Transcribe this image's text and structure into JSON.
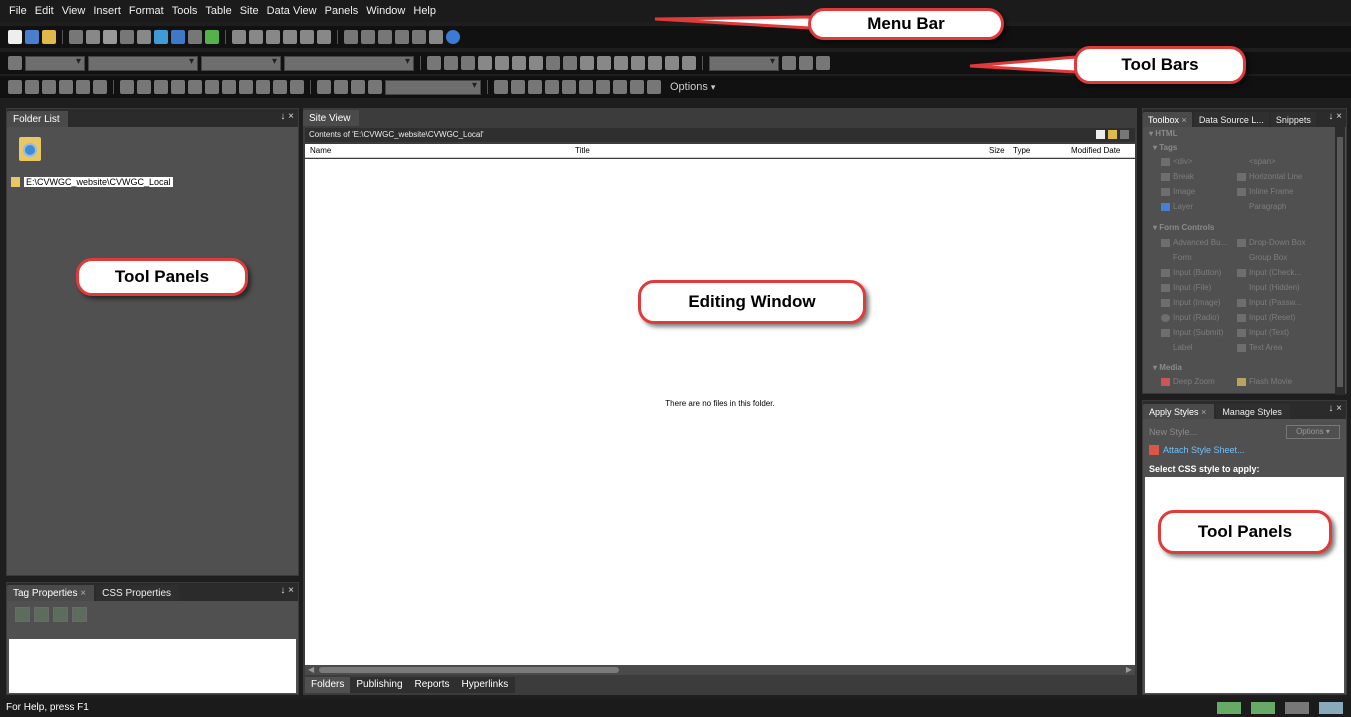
{
  "menu": [
    "File",
    "Edit",
    "View",
    "Insert",
    "Format",
    "Tools",
    "Table",
    "Site",
    "Data View",
    "Panels",
    "Window",
    "Help"
  ],
  "toolbar": {
    "options_label": "Options",
    "options_chevron": "▾"
  },
  "folder_list": {
    "tab": "Folder List",
    "pin": "↓ ×",
    "path": "E:\\CVWGC_website\\CVWGC_Local"
  },
  "tag_properties": {
    "tab1": "Tag Properties",
    "tab2": "CSS Properties",
    "close": "×",
    "pin": "↓ ×"
  },
  "site_view": {
    "tab": "Site View",
    "contents_label": "Contents of 'E:\\CVWGC_website\\CVWGC_Local'",
    "columns": [
      "Name",
      "Title",
      "Size",
      "Type",
      "Modified Date"
    ],
    "empty_message": "There are no files in this folder.",
    "bottom_tabs": [
      "Folders",
      "Publishing",
      "Reports",
      "Hyperlinks"
    ]
  },
  "toolbox": {
    "tabs": [
      "Toolbox",
      "Data Source L...",
      "Snippets"
    ],
    "close": "×",
    "pin": "↓ ×",
    "section": "HTML",
    "groups": [
      {
        "label": "Tags",
        "items": [
          "<div>",
          "<span>",
          "Break",
          "Horizontal Line",
          "Image",
          "Inline Frame",
          "Layer",
          "Paragraph"
        ]
      },
      {
        "label": "Form Controls",
        "items": [
          "Advanced Bu...",
          "Drop-Down Box",
          "Form",
          "Group Box",
          "Input (Button)",
          "Input (Check...",
          "Input (File)",
          "Input (Hidden)",
          "Input (Image)",
          "Input (Passw...",
          "Input (Radio)",
          "Input (Reset)",
          "Input (Submit)",
          "Input (Text)",
          "Label",
          "Text Area"
        ]
      },
      {
        "label": "Media",
        "items": [
          "Deep Zoom",
          "Flash Movie"
        ]
      }
    ]
  },
  "styles_panel": {
    "tabs": [
      "Apply Styles",
      "Manage Styles"
    ],
    "close": "×",
    "pin": "↓ ×",
    "new_style": "New Style...",
    "options": "Options",
    "attach": "Attach Style Sheet...",
    "select_label": "Select CSS style to apply:"
  },
  "status": {
    "text": "For Help, press F1"
  },
  "callouts": {
    "menu_bar": "Menu Bar",
    "tool_bars": "Tool Bars",
    "tool_panels_left": "Tool Panels",
    "editing_window": "Editing Window",
    "tool_panels_right": "Tool Panels"
  },
  "colors": {
    "callout_border": "#e03a3a",
    "background": "#1e1e1e",
    "link": "#6ec0ff"
  }
}
